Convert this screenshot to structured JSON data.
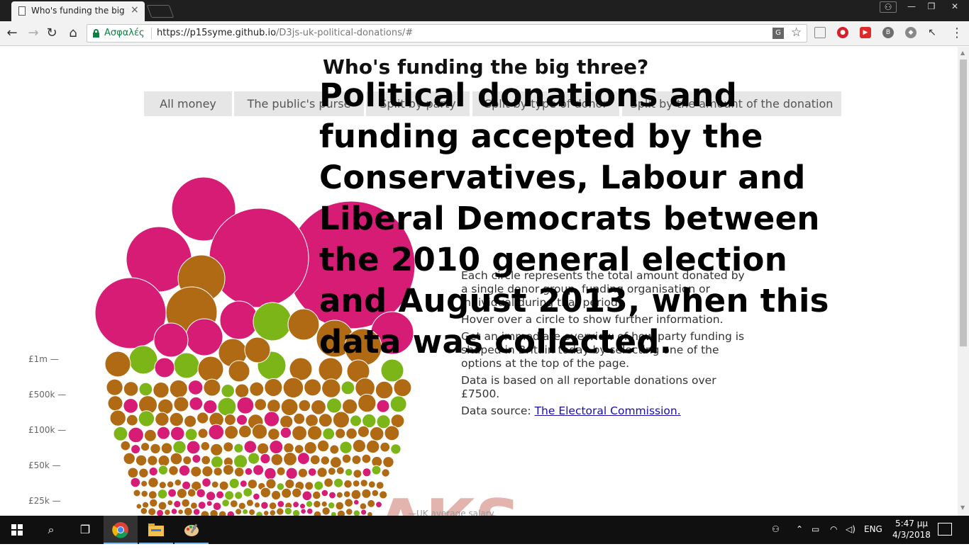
{
  "browser": {
    "tab_title": "Who's funding the big th",
    "tab_close": "×",
    "secure_label": "Ασφαλές",
    "url_host": "https://p15syme.github.io",
    "url_path": "/D3js-uk-political-donations/#"
  },
  "page": {
    "heading": "Who's funding the big three?",
    "nav": [
      {
        "label": "All money"
      },
      {
        "label": "The public's purse"
      },
      {
        "label": "Split by party"
      },
      {
        "label": "Split by type of donor"
      },
      {
        "label": "Split by the amount of the donation"
      }
    ],
    "overlay_title": "Political donations and funding accepted by the Conservatives, Labour and Liberal Democrats between the 2010 general election and August 2013, when this data was collected.",
    "info": {
      "p1": "Each circle represents the total amount donated by a single donor group, funding organisation or individual during that period.",
      "p2": "Hover over a circle to show further information.",
      "p3": "Get an immediate overview of how party funding is shaped in Britain today by selecting one of the options at the top of the page.",
      "p4": "Data is based on all reportable donations over £7500.",
      "source_prefix": "Data source: ",
      "source_link": "The Electoral Commission."
    },
    "y_axis": [
      "£1m —",
      "£500k —",
      "£100k —",
      "£50k —",
      "£25k —"
    ],
    "avg_salary": "—UK average salary",
    "ghost_text": "AKS",
    "colors": {
      "conservative": "#d61c74",
      "labour": "#b06a13",
      "libdem": "#7cb518"
    }
  },
  "taskbar": {
    "lang": "ENG",
    "time": "5:47 μμ",
    "date": "4/3/2018"
  }
}
